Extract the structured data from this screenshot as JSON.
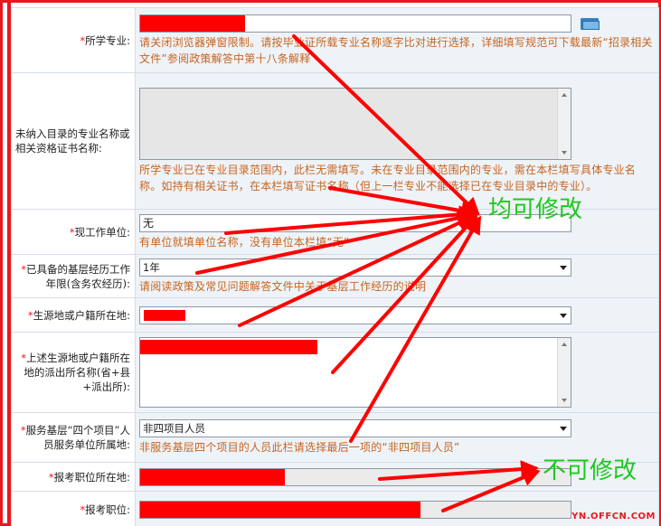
{
  "rows": {
    "major": {
      "label": "所学专业:",
      "hint": "请关闭浏览器弹窗限制。请按毕业证所载专业名称逐字比对进行选择，详细填写规范可下载最新“招录相关文件”参阅政策解答中第十八条解释",
      "browse_icon": "folder-icon"
    },
    "unlisted_major": {
      "label": "未纳入目录的专业名称或相关资格证书名称:",
      "hint": "所学专业已在专业目录范围内，此栏无需填写。未在专业目录范围内的专业，需在本栏填写具体专业名称。如持有相关证书，在本栏填写证书名称（但上一栏专业不能选择已在专业目录中的专业）。"
    },
    "employer": {
      "label": "现工作单位:",
      "value": "无",
      "hint": "有单位就填单位名称，没有单位本栏填“无”"
    },
    "grassroots_years": {
      "label": "已具备的基层经历工作年限(含务农经历):",
      "value": "1年",
      "hint": "请阅读政策及常见问题解答文件中关于基层工作经历的说明"
    },
    "hukou": {
      "label": "生源地或户籍所在地:"
    },
    "police_station": {
      "label": "上述生源地或户籍所在地的派出所名称(省+县+派出所):"
    },
    "four_projects": {
      "label": "服务基层“四个项目”人员服务单位所属地:",
      "value": "非四项目人员",
      "hint": "非服务基层四个项目的人员此栏请选择最后一项的“非四项目人员”"
    },
    "post_location": {
      "label": "报考职位所在地:"
    },
    "post": {
      "label": "报考职位:"
    }
  },
  "annotations": {
    "editable": "均可修改",
    "not_editable": "不可修改"
  },
  "watermark": "YN.OFFCN.COM",
  "colors": {
    "accent_red": "#e8181e",
    "annotation_green": "#1ec81e",
    "hint_orange": "#c8641e",
    "field_bg": "#eef3f8"
  }
}
